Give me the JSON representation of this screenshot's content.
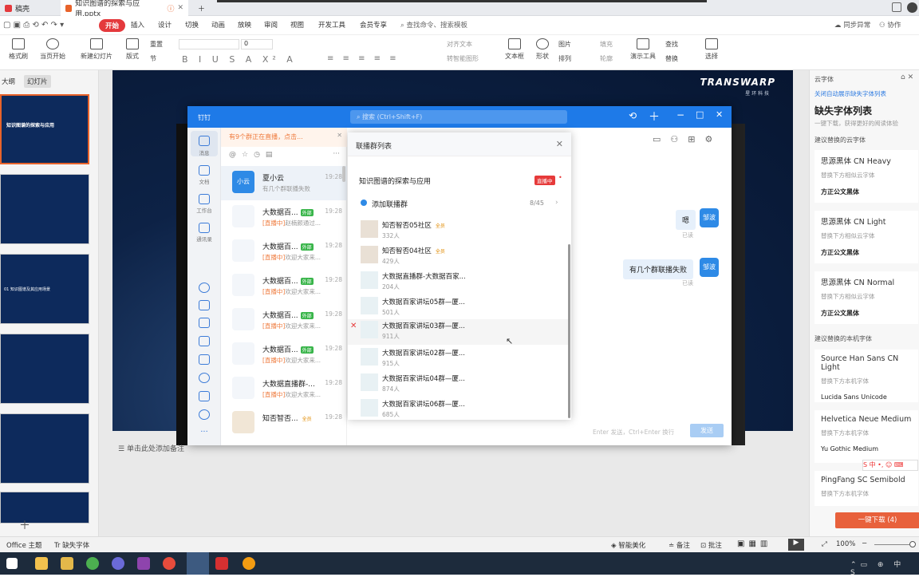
{
  "tabs": {
    "home": "稿壳",
    "file": "知识图谱的探索与应用.pptx"
  },
  "menu": [
    "开始",
    "插入",
    "设计",
    "切换",
    "动画",
    "放映",
    "审阅",
    "视图",
    "开发工具",
    "会员专享"
  ],
  "menu_search": "查找命令、搜索模板",
  "menu_right": {
    "sync": "同步异常",
    "collab": "协作"
  },
  "ribbon": {
    "format_painter": "格式刷",
    "play_current": "当页开始",
    "new_slide": "新建幻灯片",
    "layout": "版式",
    "section": "节",
    "reset": "重置",
    "size_value": "0",
    "align_text": "对齐文本",
    "convert_smartart": "转智能图形",
    "textbox": "文本框",
    "shape": "形状",
    "picture": "图片",
    "arrange": "排列",
    "fill": "填充",
    "outline": "轮廓",
    "presentation_tool": "演示工具",
    "find": "查找",
    "replace": "替换",
    "select": "选择"
  },
  "left_tabs": {
    "outline": "大纲",
    "slides": "幻灯片"
  },
  "slide_thumbs": [
    {
      "num": "",
      "title": "知识图谱的探索与应用"
    },
    {
      "num": "",
      "title": ""
    },
    {
      "num": "",
      "title": "01 知识图谱及其应用场景"
    },
    {
      "num": "",
      "title": ""
    },
    {
      "num": "",
      "title": ""
    },
    {
      "num": "",
      "title": ""
    }
  ],
  "slide_logo": {
    "main": "TRANSWARP",
    "sub": "星 环 科 技"
  },
  "notes": "单击此处添加备注",
  "right_panel": {
    "header": "云字体",
    "link": "关闭自动展示缺失字体列表",
    "title": "缺失字体列表",
    "subtitle": "一键下载，获得更好的阅读体验",
    "cloud_section": "建议替换的云字体",
    "cloud_fonts": [
      {
        "name": "思源黑体 CN Heavy",
        "sub": "替换下方相似云字体",
        "alt": "方正公文黑体"
      },
      {
        "name": "思源黑体 CN Light",
        "sub": "替换下方相似云字体",
        "alt": "方正公文黑体"
      },
      {
        "name": "思源黑体 CN Normal",
        "sub": "替换下方相似云字体",
        "alt": "方正公文黑体"
      }
    ],
    "local_section": "建议替换的本机字体",
    "local_fonts": [
      {
        "name": "Source Han Sans CN Light",
        "sub": "替换下方本机字体",
        "alt": "Lucida Sans Unicode"
      },
      {
        "name": "Helvetica Neue Medium",
        "sub": "替换下方本机字体",
        "alt": "Yu Gothic Medium"
      },
      {
        "name": "PingFang SC Semibold",
        "sub": "替换下方本机字体",
        "alt": ""
      }
    ],
    "download": "一键下载 (4)"
  },
  "status": {
    "theme": "Office 主题",
    "missing_font": "缺失字体",
    "smart_beautify": "智能美化",
    "notes": "备注",
    "comment": "批注",
    "zoom": "100%"
  },
  "app": {
    "title": "钉钉",
    "search_placeholder": "搜索 (Ctrl+Shift+F)",
    "nav": [
      {
        "label": "消息"
      },
      {
        "label": "文档"
      },
      {
        "label": "工作台"
      },
      {
        "label": "通讯录"
      }
    ],
    "banner": "有9个群正在直播，点击...",
    "conversations": [
      {
        "name": "夏小云",
        "time": "19:28",
        "msg": "有几个群联播失败",
        "avatar": "小云",
        "live": "",
        "tag": ""
      },
      {
        "name": "大数据百...",
        "time": "19:28",
        "msg": "赵楠颜通过...",
        "avatar": "",
        "live": "[直播中]",
        "tag": "外部"
      },
      {
        "name": "大数据百...",
        "time": "19:28",
        "msg": "欢迎大家来...",
        "avatar": "",
        "live": "[直播中]",
        "tag": "外部"
      },
      {
        "name": "大数据百...",
        "time": "19:28",
        "msg": "欢迎大家来...",
        "avatar": "",
        "live": "[直播中]",
        "tag": "外部"
      },
      {
        "name": "大数据百...",
        "time": "19:28",
        "msg": "欢迎大家来...",
        "avatar": "",
        "live": "[直播中]",
        "tag": "外部"
      },
      {
        "name": "大数据百...",
        "time": "19:28",
        "msg": "欢迎大家来...",
        "avatar": "",
        "live": "[直播中]",
        "tag": "外部"
      },
      {
        "name": "大数据直播群-...",
        "time": "19:28",
        "msg": "欢迎大家来...",
        "avatar": "",
        "live": "[直播中]",
        "tag": ""
      },
      {
        "name": "知否智否...",
        "time": "19:28",
        "msg": "",
        "avatar": "",
        "live": "",
        "tag": "全员"
      }
    ],
    "chat": {
      "bubble1": "嗯",
      "bubble2": "有几个群联播失败",
      "avatar": "邹波",
      "read": "已读",
      "input_hint": "Enter 发送，Ctrl+Enter 换行",
      "send": "发送"
    },
    "modal": {
      "title": "联播群列表",
      "event": "知识图谱的探索与应用",
      "live_badge": "直播中",
      "add_label": "添加联播群",
      "add_count": "8/45",
      "groups": [
        {
          "name": "知否智否05社区",
          "count": "332人",
          "tag": "全员",
          "failed": false
        },
        {
          "name": "知否智否04社区",
          "count": "429人",
          "tag": "全员",
          "failed": false
        },
        {
          "name": "大数据直播群-大数据百家...",
          "count": "204人",
          "tag": "",
          "failed": false
        },
        {
          "name": "大数据百家讲坛05群—厦...",
          "count": "501人",
          "tag": "",
          "failed": false
        },
        {
          "name": "大数据百家讲坛03群—厦...",
          "count": "911人",
          "tag": "",
          "failed": true
        },
        {
          "name": "大数据百家讲坛02群—厦...",
          "count": "915人",
          "tag": "",
          "failed": false
        },
        {
          "name": "大数据百家讲坛04群—厦...",
          "count": "874人",
          "tag": "",
          "failed": false
        },
        {
          "name": "大数据百家讲坛06群—厦...",
          "count": "685人",
          "tag": "",
          "failed": false
        }
      ]
    }
  }
}
